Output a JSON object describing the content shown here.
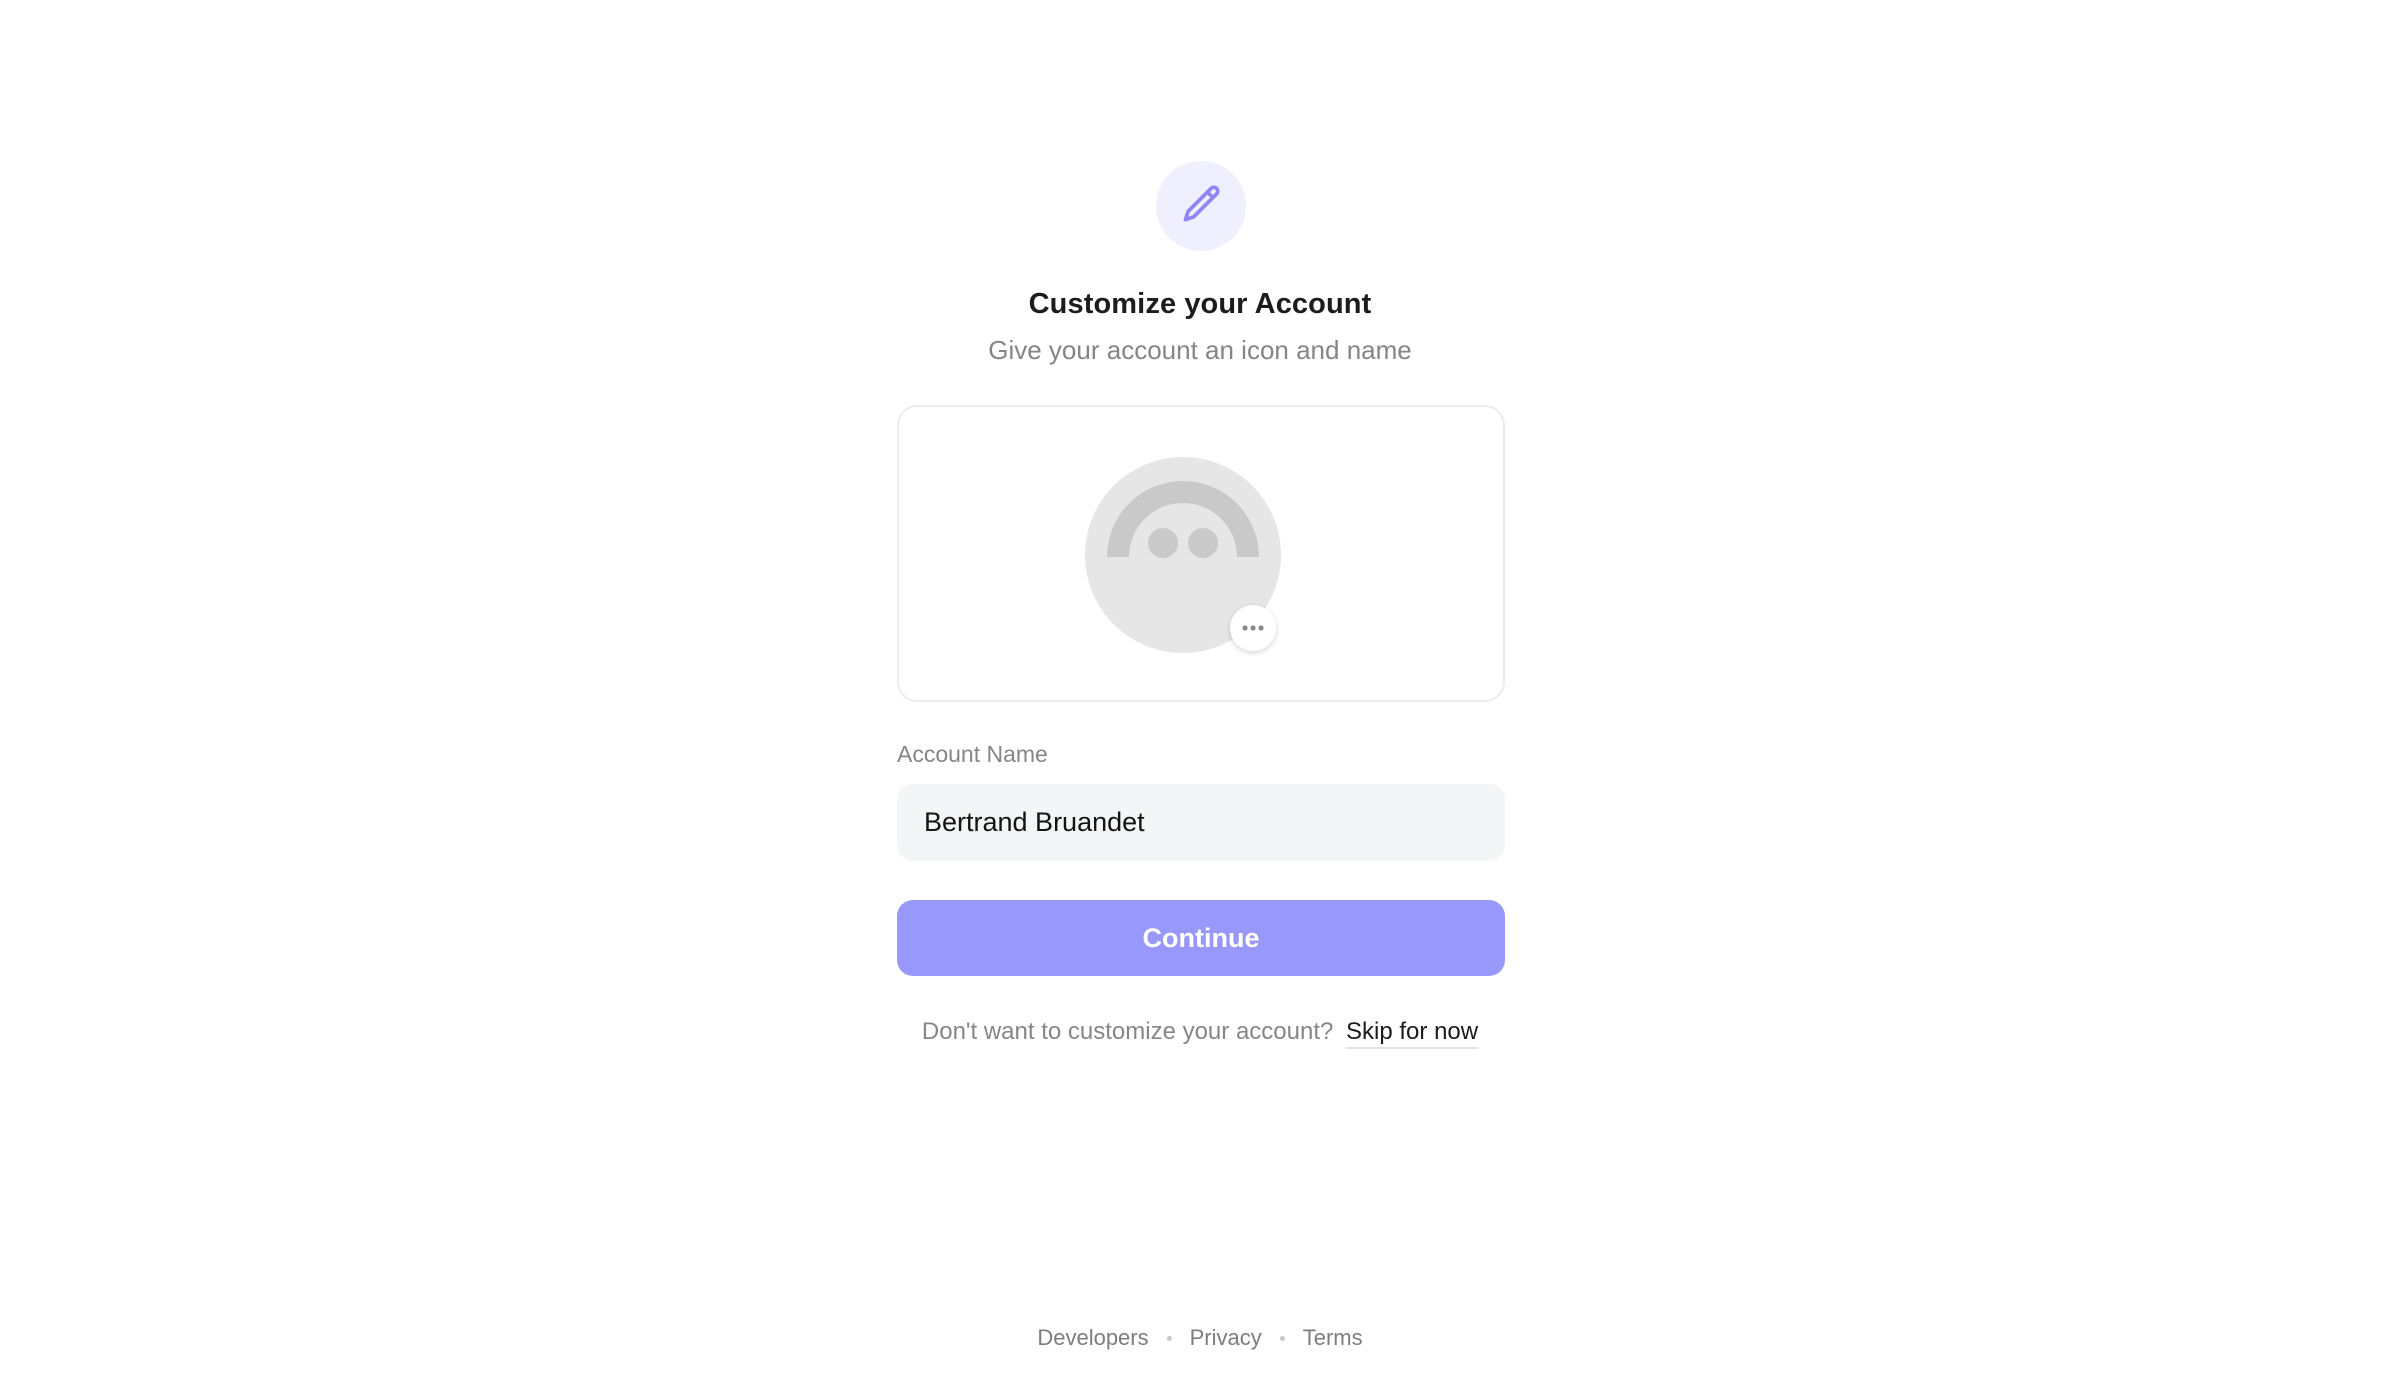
{
  "header": {
    "icon": "pencil-icon",
    "title": "Customize your Account",
    "subtitle": "Give your account an icon and name"
  },
  "avatar": {
    "icon": "avatar-placeholder-icon",
    "menu_icon": "more-horizontal-icon"
  },
  "form": {
    "account_name_label": "Account Name",
    "account_name_value": "Bertrand Bruandet",
    "continue_label": "Continue"
  },
  "skip": {
    "prompt": "Don't want to customize your account?",
    "link_label": "Skip for now"
  },
  "footer": {
    "links": [
      "Developers",
      "Privacy",
      "Terms"
    ]
  },
  "colors": {
    "accent": "#9898fb",
    "accent_icon": "#8f86f3",
    "icon_bg": "#f0effd",
    "input_bg": "#f4f5f7"
  }
}
